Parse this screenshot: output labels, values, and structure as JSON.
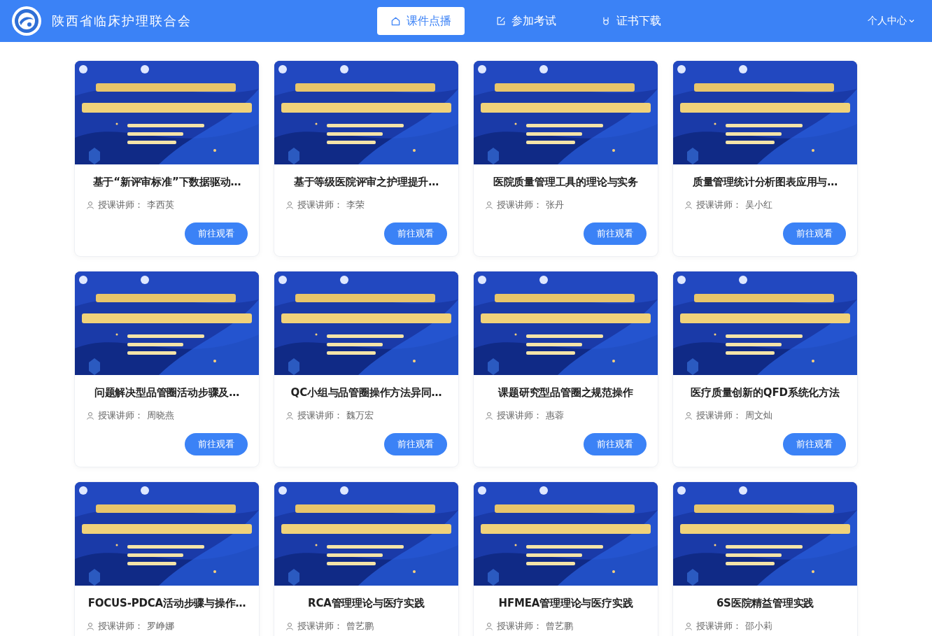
{
  "header": {
    "site_title": "陕西省临床护理联合会",
    "nav": [
      {
        "label": "课件点播",
        "selected": true
      },
      {
        "label": "参加考试",
        "selected": false
      },
      {
        "label": "证书下载",
        "selected": false
      }
    ],
    "user_menu": "个人中心"
  },
  "courses": [
    {
      "title": "基于“新评审标准”下数据驱动…",
      "teacher_label": "授课讲师：",
      "teacher": "李西英",
      "button": "前往观看"
    },
    {
      "title": "基于等级医院评审之护理提升…",
      "teacher_label": "授课讲师：",
      "teacher": "李荣",
      "button": "前往观看"
    },
    {
      "title": "医院质量管理工具的理论与实务",
      "teacher_label": "授课讲师：",
      "teacher": "张丹",
      "button": "前往观看"
    },
    {
      "title": "质量管理统计分析图表应用与…",
      "teacher_label": "授课讲师：",
      "teacher": "吴小红",
      "button": "前往观看"
    },
    {
      "title": "问题解决型品管圈活动步骤及…",
      "teacher_label": "授课讲师：",
      "teacher": "周晓燕",
      "button": "前往观看"
    },
    {
      "title": "QC小组与品管圈操作方法异同…",
      "teacher_label": "授课讲师：",
      "teacher": "魏万宏",
      "button": "前往观看"
    },
    {
      "title": "课题研究型品管圈之规范操作",
      "teacher_label": "授课讲师：",
      "teacher": "惠蓉",
      "button": "前往观看"
    },
    {
      "title": "医疗质量创新的QFD系统化方法",
      "teacher_label": "授课讲师：",
      "teacher": "周文灿",
      "button": "前往观看"
    },
    {
      "title": "FOCUS-PDCA活动步骤与操作…",
      "teacher_label": "授课讲师：",
      "teacher": "罗峥娜"
    },
    {
      "title": "RCA管理理论与医疗实践",
      "teacher_label": "授课讲师：",
      "teacher": "曾艺鹏"
    },
    {
      "title": "HFMEA管理理论与医疗实践",
      "teacher_label": "授课讲师：",
      "teacher": "曾艺鹏"
    },
    {
      "title": "6S医院精益管理实践",
      "teacher_label": "授课讲师：",
      "teacher": "邵小莉"
    }
  ]
}
